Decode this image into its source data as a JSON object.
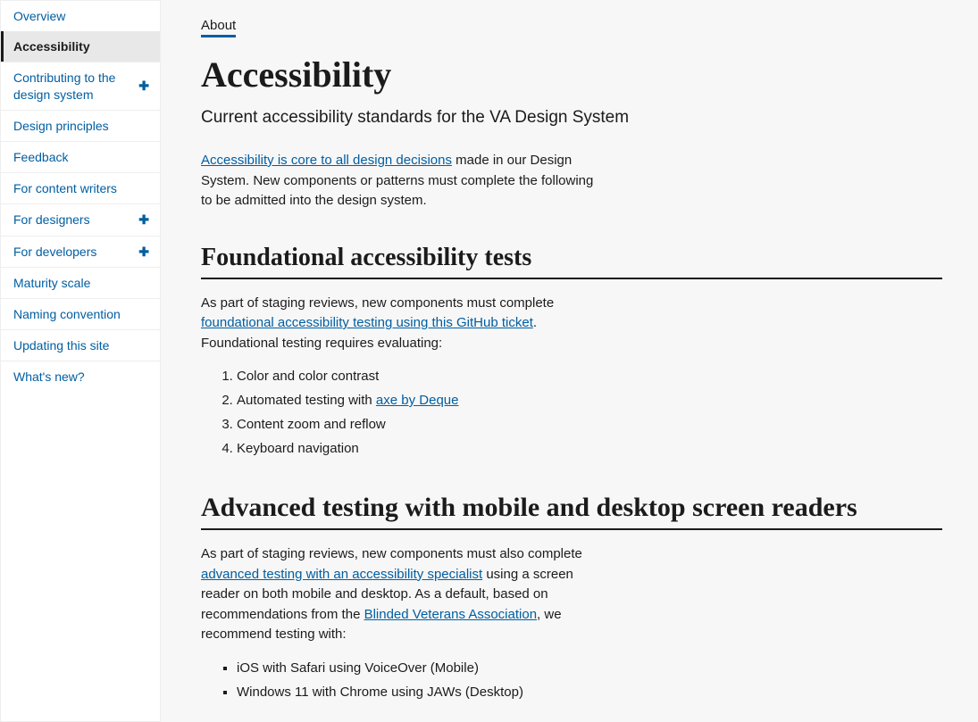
{
  "sidebar": {
    "items": [
      {
        "label": "Overview",
        "active": false,
        "expandable": false
      },
      {
        "label": "Accessibility",
        "active": true,
        "expandable": false
      },
      {
        "label": "Contributing to the design system",
        "active": false,
        "expandable": true
      },
      {
        "label": "Design principles",
        "active": false,
        "expandable": false
      },
      {
        "label": "Feedback",
        "active": false,
        "expandable": false
      },
      {
        "label": "For content writers",
        "active": false,
        "expandable": false
      },
      {
        "label": "For designers",
        "active": false,
        "expandable": true
      },
      {
        "label": "For developers",
        "active": false,
        "expandable": true
      },
      {
        "label": "Maturity scale",
        "active": false,
        "expandable": false
      },
      {
        "label": "Naming convention",
        "active": false,
        "expandable": false
      },
      {
        "label": "Updating this site",
        "active": false,
        "expandable": false
      },
      {
        "label": "What's new?",
        "active": false,
        "expandable": false
      }
    ]
  },
  "breadcrumb": "About",
  "title": "Accessibility",
  "subtitle": "Current accessibility standards for the VA Design System",
  "intro": {
    "link": "Accessibility is core to all design decisions",
    "rest": " made in our Design System. New components or patterns must complete the following to be admitted into the design system."
  },
  "section1": {
    "heading": "Foundational accessibility tests",
    "p_pre": "As part of staging reviews, new components must complete ",
    "p_link": "foundational accessibility testing using this GitHub ticket",
    "p_post": ". Foundational testing requires evaluating:",
    "items": [
      "Color and color contrast",
      "Automated testing with ",
      "Content zoom and reflow",
      "Keyboard navigation"
    ],
    "item2_link": "axe by Deque"
  },
  "section2": {
    "heading": "Advanced testing with mobile and desktop screen readers",
    "p_pre": "As part of staging reviews, new components must also complete ",
    "p_link1": "advanced testing with an accessibility specialist",
    "p_mid": " using a screen reader on both mobile and desktop. As a default, based on recommendations from the ",
    "p_link2": "Blinded Veterans Association",
    "p_post": ", we recommend testing with:",
    "items": [
      "iOS with Safari using VoiceOver (Mobile)",
      "Windows 11 with Chrome using JAWs (Desktop)"
    ]
  }
}
